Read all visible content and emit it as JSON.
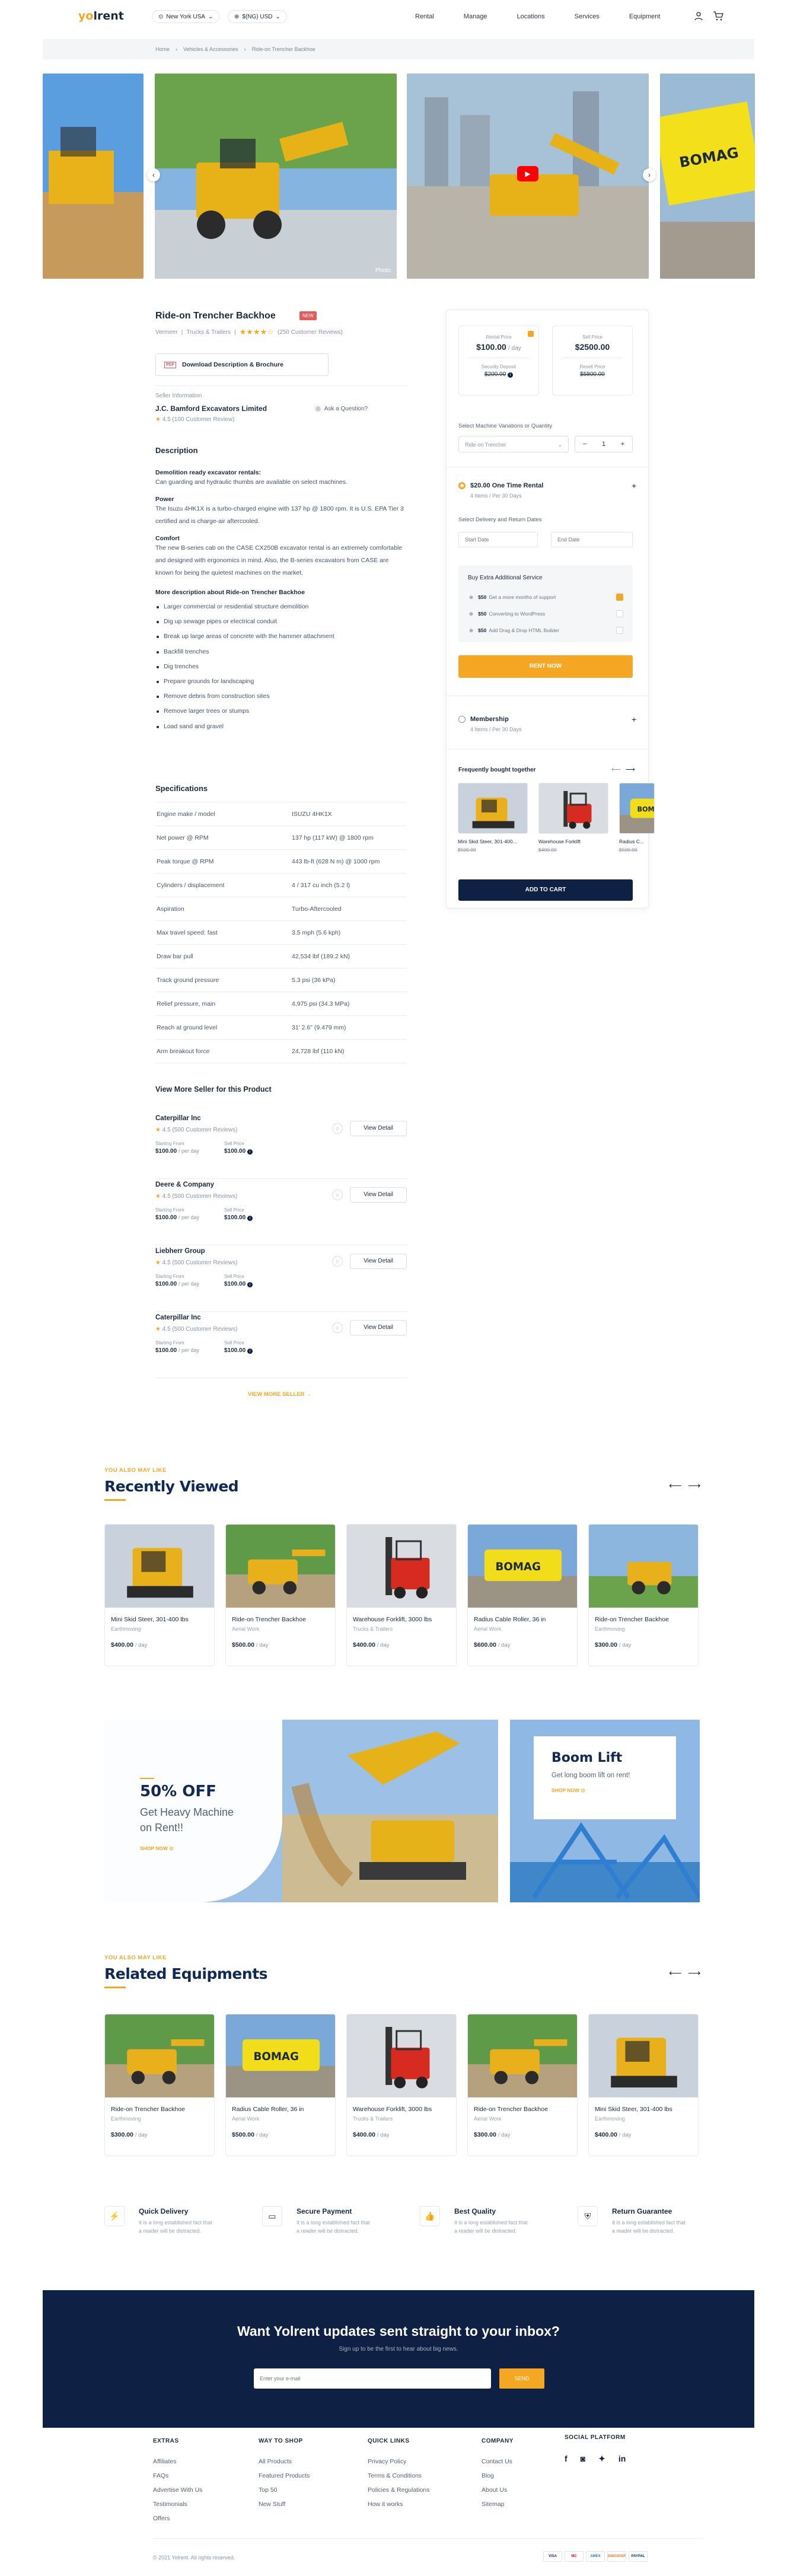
{
  "header": {
    "logo": "yolrent",
    "location": "New York USA",
    "currency": "$(NG) USD",
    "nav": [
      "Rental",
      "Manage",
      "Locations",
      "Services",
      "Equipment"
    ]
  },
  "breadcrumb": [
    "Home",
    "Vehicles & Accessories",
    "Ride-on Trencher Backhoe"
  ],
  "gallery": {
    "caption": "Photo"
  },
  "product": {
    "title": "Ride-on Trencher Backhoe",
    "badge": "NEW",
    "category": "Vermeer",
    "subcategory": "Trucks & Trailers",
    "rating_text": "(250 Customer Reviews)",
    "brochure": "Download Description & Brochure",
    "seller_heading": "Seller Information",
    "seller_name": "J.C. Bamford Excavators Limited",
    "seller_rating": "4.5 (100 Customer Review)",
    "ask": "Ask a Question?"
  },
  "description": {
    "title": "Description",
    "h1": "Demolition ready excavator rentals:",
    "p1": "Can guarding and hydraulic thumbs are available on select machines.",
    "h2": "Power",
    "p2": "The Isuzu 4HK1X is a turbo-charged engine with 137 hp @ 1800 rpm. It is U.S. EPA Tier 3 certified and is charge-air aftercooled.",
    "h3": "Comfort",
    "p3": "The new B-series cab on the CASE CX250B excavator rental is an extremely comfortable and designed with ergonomics in mind. Also, the B-series excavators from CASE are known for being the quietest machines on the market.",
    "h4": "More description about Ride-on Trencher Backhoe",
    "bullets": [
      "Larger commercial or residential structure demolition",
      "Dig up sewage pipes or electrical conduit",
      "Break up large areas of concrete with the hammer attachment",
      "Backfill trenches",
      "Dig trenches",
      "Prepare grounds for landscaping",
      "Remove debris from construction sites",
      "Remove larger trees or stumps",
      "Load sand and gravel"
    ]
  },
  "specs": {
    "title": "Specifications",
    "rows": [
      [
        "Engine make / model",
        "ISUZU 4HK1X"
      ],
      [
        "Net power @ RPM",
        "137 hp (117 kW) @ 1800 rpm"
      ],
      [
        "Peak torque @ RPM",
        "443 lb-ft (628 N m) @ 1000 rpm"
      ],
      [
        "Cylinders / displacement",
        "4 / 317 cu inch (5.2 l)"
      ],
      [
        "Aspiration",
        "Turbo-Aftercooled"
      ],
      [
        "Max travel speed: fast",
        "3.5 mph (5.6 kph)"
      ],
      [
        "Draw bar pull",
        "42,534 lbf (189.2 kN)"
      ],
      [
        "Track ground pressure",
        "5.3 psi (36 kPa)"
      ],
      [
        "Relief pressure, main",
        "4,975 psi (34.3 MPa)"
      ],
      [
        "Reach at ground level",
        "31' 2.6\" (9.479 mm)"
      ],
      [
        "Arm breakout force",
        "24,728 lbf (110 kN)"
      ]
    ]
  },
  "more_sellers": {
    "title": "View More Seller for this Product",
    "view_more": "VIEW MORE SELLER →",
    "rating": "4.5 (500 Customer Reviews)",
    "starting_label": "Starting From",
    "sell_label": "Sell Price",
    "starting": "$100.00",
    "per": "/ per day",
    "sell": "$100.00",
    "view_detail": "View Detail",
    "names": [
      "Caterpillar Inc",
      "Deere & Company",
      "Liebherr Group",
      "Caterpillar Inc"
    ]
  },
  "sidebar": {
    "rental_label": "Rental Price",
    "rental_price": "$100.00",
    "rental_per": "/ day",
    "sell_label": "Sell Price",
    "sell_price": "$2500.00",
    "deposit_label": "Security Deposit",
    "deposit": "$200.00",
    "resale_label": "Resell Price",
    "resale": "$5800.00",
    "variation_label": "Select Machine Variations or Quantity",
    "variation_value": "Ride-on Trencher",
    "qty": "1",
    "one_time": "$20.00 One Time Rental",
    "one_time_sub": "4 Items / Per 30 Days",
    "dates_label": "Select Delivery and Return Dates",
    "start": "Start Date",
    "end": "End Date",
    "extra_title": "Buy Extra Additional Service",
    "extras": [
      [
        "$50",
        "Get a more months of support"
      ],
      [
        "$50",
        "Converting to WordPress"
      ],
      [
        "$50",
        "Add Drag & Drop HTML Builder"
      ]
    ],
    "rent_now": "RENT NOW",
    "membership": "Membership",
    "membership_sub": "4 Items / Per 30 Days",
    "fbt": "Frequently bought together",
    "fbt_items": [
      [
        "Mini Skid Steer, 301-400...",
        "$500.00"
      ],
      [
        "Warehouse Forklift",
        "$400.00"
      ],
      [
        "Radius C...",
        "$500.00"
      ]
    ],
    "add_to_cart": "ADD TO CART"
  },
  "recent": {
    "kicker": "YOU ALSO MAY LIKE",
    "title": "Recently Viewed",
    "items": [
      [
        "Mini Skid Steer, 301-400 lbs",
        "Earthmoving",
        "$400.00"
      ],
      [
        "Ride-on Trencher Backhoe",
        "Aerial Work",
        "$500.00"
      ],
      [
        "Warehouse Forklift, 3000 lbs",
        "Trucks & Trailers",
        "$400.00"
      ],
      [
        "Radius Cable Roller, 36 in",
        "Aerial Work",
        "$600.00"
      ],
      [
        "Ride-on Trencher Backhoe",
        "Earthmoving",
        "$300.00"
      ]
    ],
    "per": "/ day"
  },
  "promo": {
    "off": "50% OFF",
    "line1": "Get Heavy Machine",
    "line2": "on Rent!!",
    "cta": "SHOP NOW",
    "boom": "Boom Lift",
    "boom_sub": "Get long boom lift on rent!",
    "boom_cta": "SHOP NOW"
  },
  "related": {
    "kicker": "YOU ALSO MAY LIKE",
    "title": "Related Equipments",
    "items": [
      [
        "Ride-on Trencher Backhoe",
        "Earthmoving",
        "$300.00"
      ],
      [
        "Radius Cable Roller, 36 in",
        "Aerial Work",
        "$500.00"
      ],
      [
        "Warehouse Forklift, 3000 lbs",
        "Trucks & Trailers",
        "$400.00"
      ],
      [
        "Ride-on Trencher Backhoe",
        "Aerial Work",
        "$300.00"
      ],
      [
        "Mini Skid Steer, 301-400 lbs",
        "Earthmoving",
        "$400.00"
      ]
    ],
    "per": "/ day"
  },
  "features": [
    [
      "Quick Delivery",
      "It is a long established fact that a reader will be distracted."
    ],
    [
      "Secure Payment",
      "It is a long established fact that a reader will be distracted."
    ],
    [
      "Best Quality",
      "It is a long established fact that a reader will be distracted."
    ],
    [
      "Return Guarantee",
      "It is a long established fact that a reader will be distracted."
    ]
  ],
  "newsletter": {
    "title": "Want Yolrent updates sent straight to your inbox?",
    "sub": "Sign up to be the first to hear about big news.",
    "placeholder": "Enter your e-mail",
    "button": "SEND"
  },
  "footer": {
    "cols": [
      {
        "h": "EXTRAS",
        "items": [
          "Affiliates",
          "FAQs",
          "Advertise With Us",
          "Testimonials",
          "Offers"
        ]
      },
      {
        "h": "WAY TO SHOP",
        "items": [
          "All Products",
          "Featured Products",
          "Top 50",
          "New Stuff"
        ]
      },
      {
        "h": "QUICK LINKS",
        "items": [
          "Privacy Policy",
          "Terms & Conditions",
          "Policies & Regulations",
          "How it works"
        ]
      },
      {
        "h": "COMPANY",
        "items": [
          "Contact Us",
          "Blog",
          "About Us",
          "Sitemap"
        ]
      }
    ],
    "social": "SOCIAL PLATFORM",
    "copyright": "© 2021 Yolrent. All rights reserved.",
    "payments": [
      "VISA",
      "MC",
      "AMEX",
      "DISCOVER",
      "PAYPAL"
    ]
  },
  "colors": {
    "accent": "#f5a623",
    "navy": "#0e2144",
    "title": "#112a55"
  }
}
